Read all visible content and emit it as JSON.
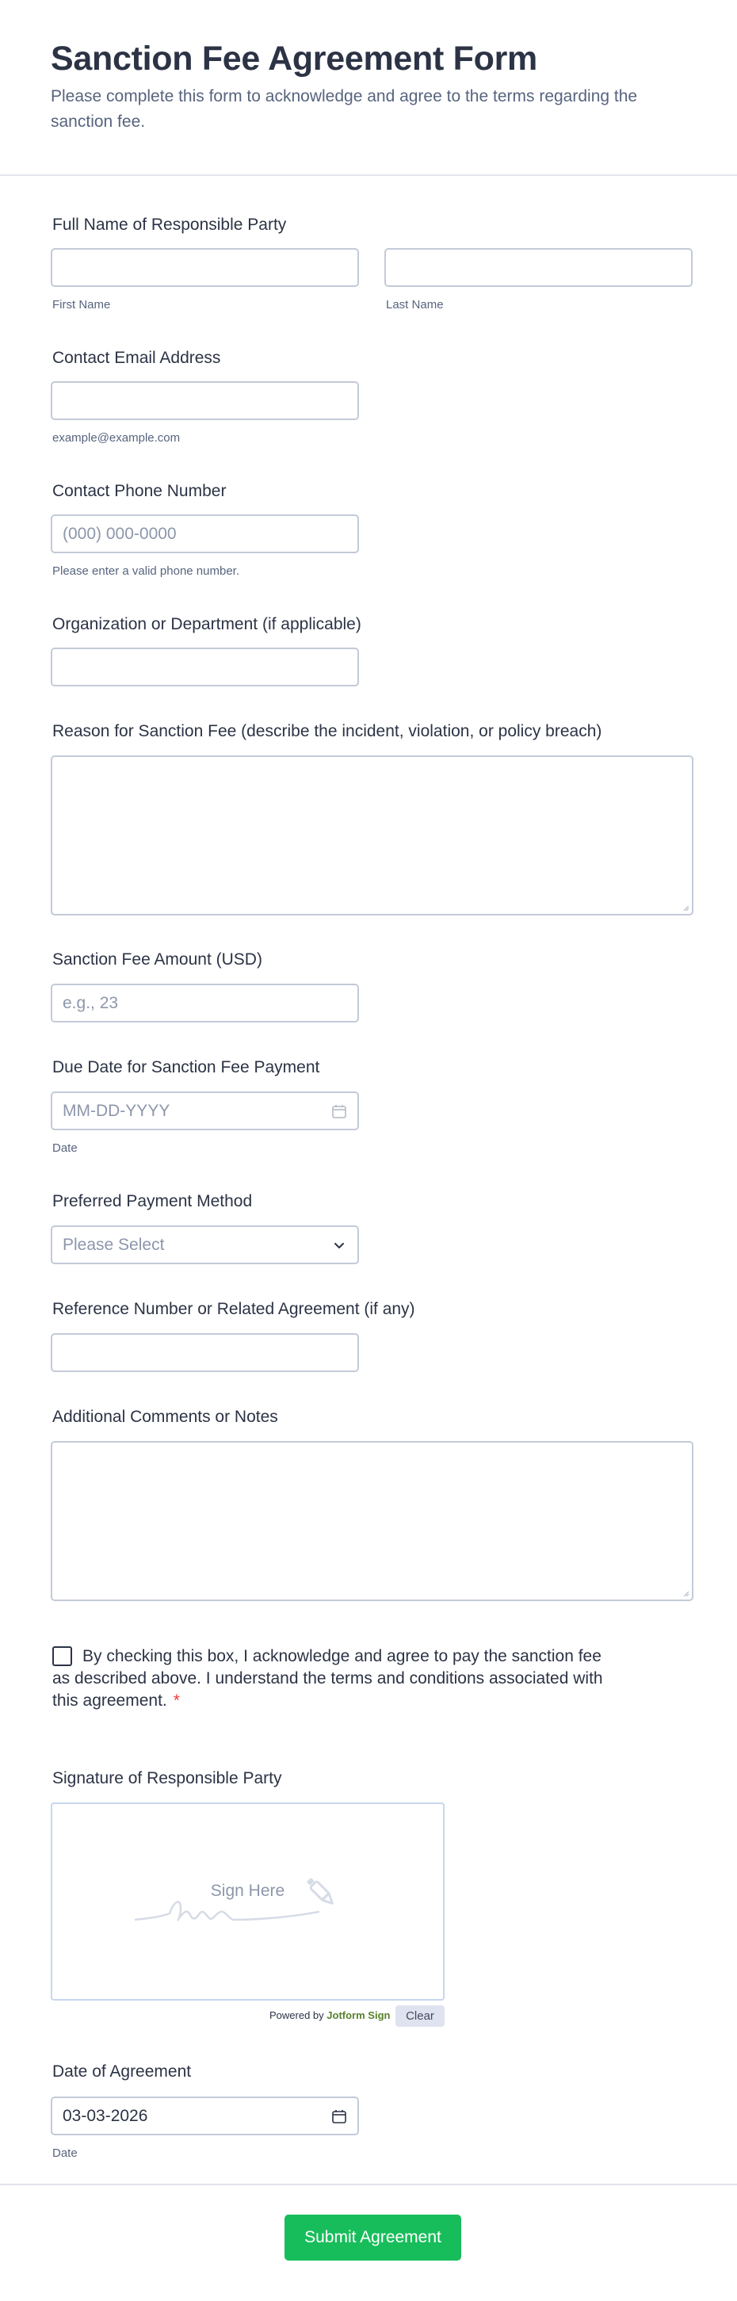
{
  "form": {
    "title": "Sanction Fee Agreement Form",
    "subtitle": "Please complete this form to acknowledge and agree to the terms regarding the sanction fee."
  },
  "fields": {
    "full_name": {
      "label": "Full Name of Responsible Party",
      "first_sublabel": "First Name",
      "last_sublabel": "Last Name",
      "first_value": "",
      "last_value": ""
    },
    "email": {
      "label": "Contact Email Address",
      "sublabel": "example@example.com",
      "value": ""
    },
    "phone": {
      "label": "Contact Phone Number",
      "placeholder": "(000) 000-0000",
      "sublabel": "Please enter a valid phone number.",
      "value": ""
    },
    "organization": {
      "label": "Organization or Department (if applicable)",
      "value": ""
    },
    "reason": {
      "label": "Reason for Sanction Fee (describe the incident, violation, or policy breach)",
      "value": ""
    },
    "amount": {
      "label": "Sanction Fee Amount (USD)",
      "placeholder": "e.g., 23",
      "value": ""
    },
    "due_date": {
      "label": "Due Date for Sanction Fee Payment",
      "placeholder": "MM-DD-YYYY",
      "sublabel": "Date",
      "icon": "calendar-icon"
    },
    "payment_method": {
      "label": "Preferred Payment Method",
      "selected": "Please Select",
      "icon": "chevron-down-icon"
    },
    "reference": {
      "label": "Reference Number or Related Agreement (if any)",
      "value": ""
    },
    "comments": {
      "label": "Additional Comments or Notes",
      "value": ""
    },
    "consent": {
      "text": "By checking this box, I acknowledge and agree to pay the sanction fee as described above. I understand the terms and conditions associated with this agreement.",
      "required_mark": "*",
      "checked": false
    },
    "signature": {
      "label": "Signature of Responsible Party",
      "pad_text": "Sign Here",
      "powered_prefix": "Powered by",
      "powered_brand": "Jotform Sign",
      "clear_label": "Clear"
    },
    "agreement_date": {
      "label": "Date of Agreement",
      "value": "03-03-2026",
      "sublabel": "Date",
      "icon": "calendar-icon"
    }
  },
  "submit_label": "Submit Agreement",
  "colors": {
    "accent": "#18bd5b",
    "required": "#f23a3c",
    "border": "#c3cad8",
    "text": "#2c3345",
    "muted": "#57647e"
  }
}
